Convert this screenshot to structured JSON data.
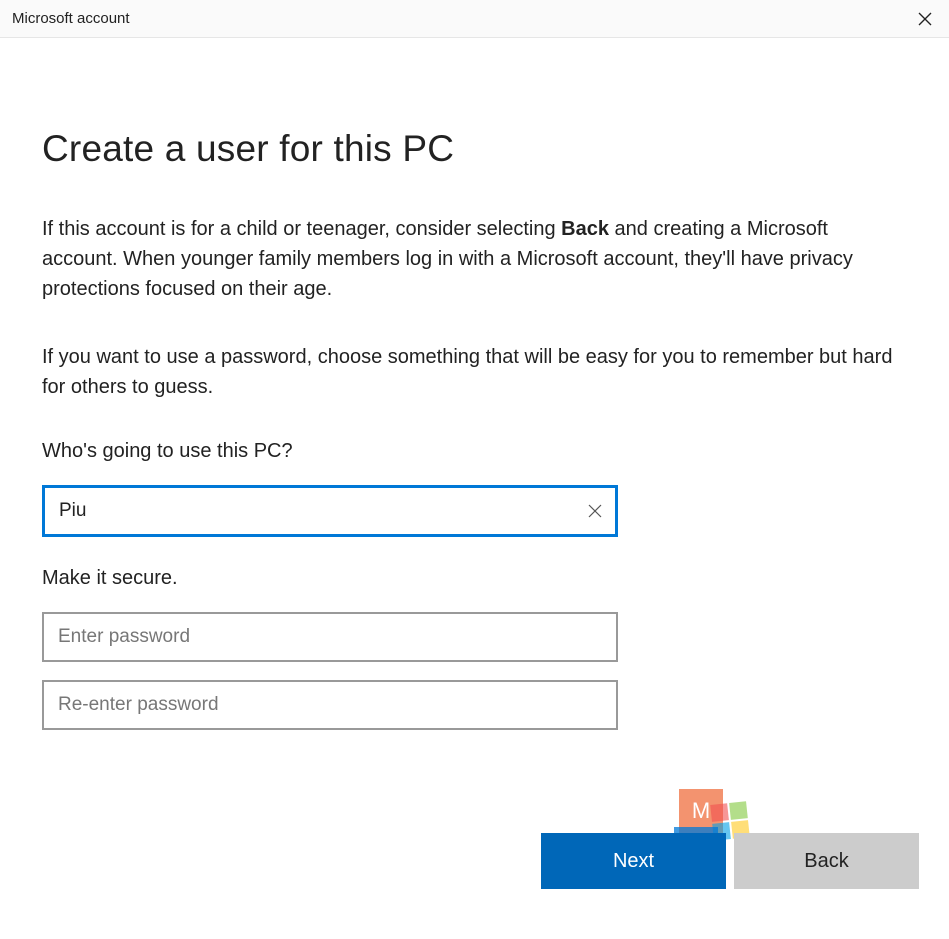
{
  "titlebar": {
    "title": "Microsoft account"
  },
  "heading": "Create a user for this PC",
  "description1_pre": "If this account is for a child or teenager, consider selecting ",
  "description1_bold": "Back",
  "description1_post": " and creating a Microsoft account. When younger family members log in with a Microsoft account, they'll have privacy protections focused on their age.",
  "description2": "If you want to use a password, choose something that will be easy for you to remember but hard for others to guess.",
  "username_section": {
    "label": "Who's going to use this PC?",
    "value": "Piu"
  },
  "password_section": {
    "label": "Make it secure.",
    "password_placeholder": "Enter password",
    "confirm_placeholder": "Re-enter password"
  },
  "footer": {
    "next_label": "Next",
    "back_label": "Back"
  },
  "colors": {
    "accent": "#0078d7",
    "button_primary": "#0067b8",
    "button_secondary": "#cccccc"
  }
}
